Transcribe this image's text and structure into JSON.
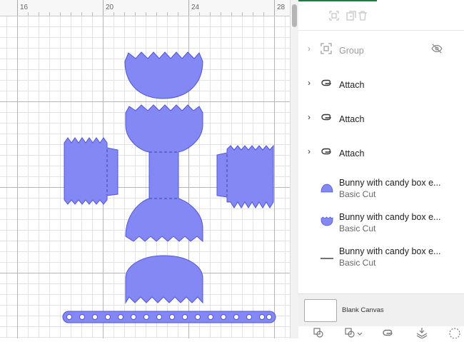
{
  "ruler": {
    "ticks": [
      "16",
      "20",
      "24",
      "28"
    ]
  },
  "colors": {
    "shape_fill": "#8488f4",
    "shape_stroke": "#4f55d8",
    "accent": "#1a7f45"
  },
  "toolbar": {
    "icons": [
      "group-icon",
      "duplicate-icon",
      "delete-icon"
    ]
  },
  "layers": [
    {
      "title": "Group",
      "subtitle": "",
      "icon": "group-icon",
      "expandable": true,
      "hidden": true
    },
    {
      "title": "Attach",
      "subtitle": "",
      "icon": "attach-icon",
      "expandable": true
    },
    {
      "title": "Attach",
      "subtitle": "",
      "icon": "attach-icon",
      "expandable": true
    },
    {
      "title": "Attach",
      "subtitle": "",
      "icon": "attach-icon",
      "expandable": true
    },
    {
      "title": "Bunny with candy box e...",
      "subtitle": "Basic Cut",
      "icon": "dome-shape-icon"
    },
    {
      "title": "Bunny with candy box e...",
      "subtitle": "Basic Cut",
      "icon": "scalloped-shape-icon"
    },
    {
      "title": "Bunny with candy box e...",
      "subtitle": "Basic Cut",
      "icon": "line-shape-icon"
    }
  ],
  "canvas_bar": {
    "label": "Blank Canvas"
  }
}
